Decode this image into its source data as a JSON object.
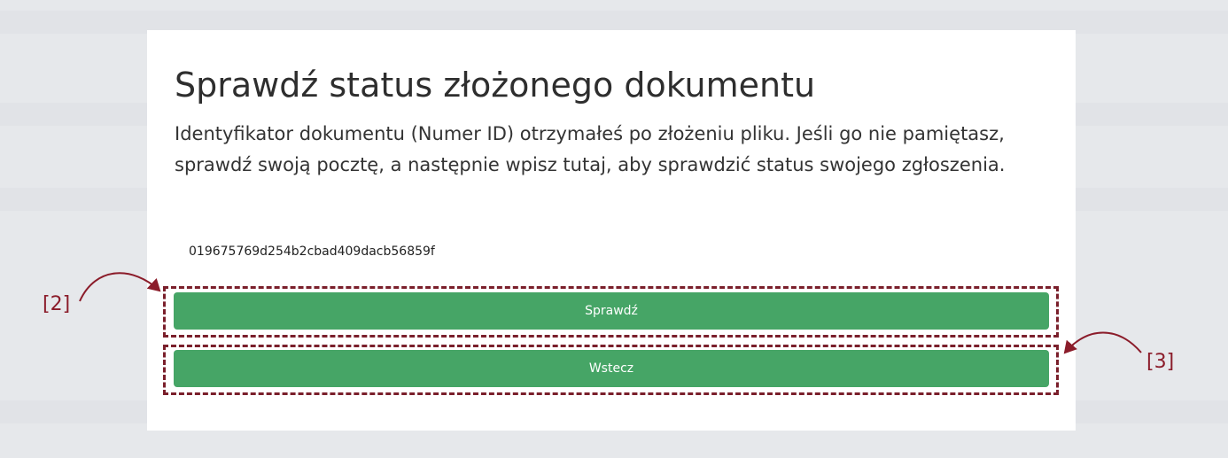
{
  "panel": {
    "title": "Sprawdź status złożonego dokumentu",
    "description": "Identyfikator dokumentu (Numer ID) otrzymałeś po złożeniu pliku. Jeśli go nie pamiętasz, sprawdź swoją pocztę, a następnie wpisz tutaj, aby sprawdzić status swojego zgłoszenia.",
    "document_id_value": "019675769d254b2cbad409dacb56859f",
    "check_button_label": "Sprawdź",
    "back_button_label": "Wstecz"
  },
  "annotations": {
    "check_marker": "[2]",
    "back_marker": "[3]",
    "color": "#7a1f2b"
  },
  "colors": {
    "button_green": "#46a566",
    "card_background": "#ffffff"
  }
}
